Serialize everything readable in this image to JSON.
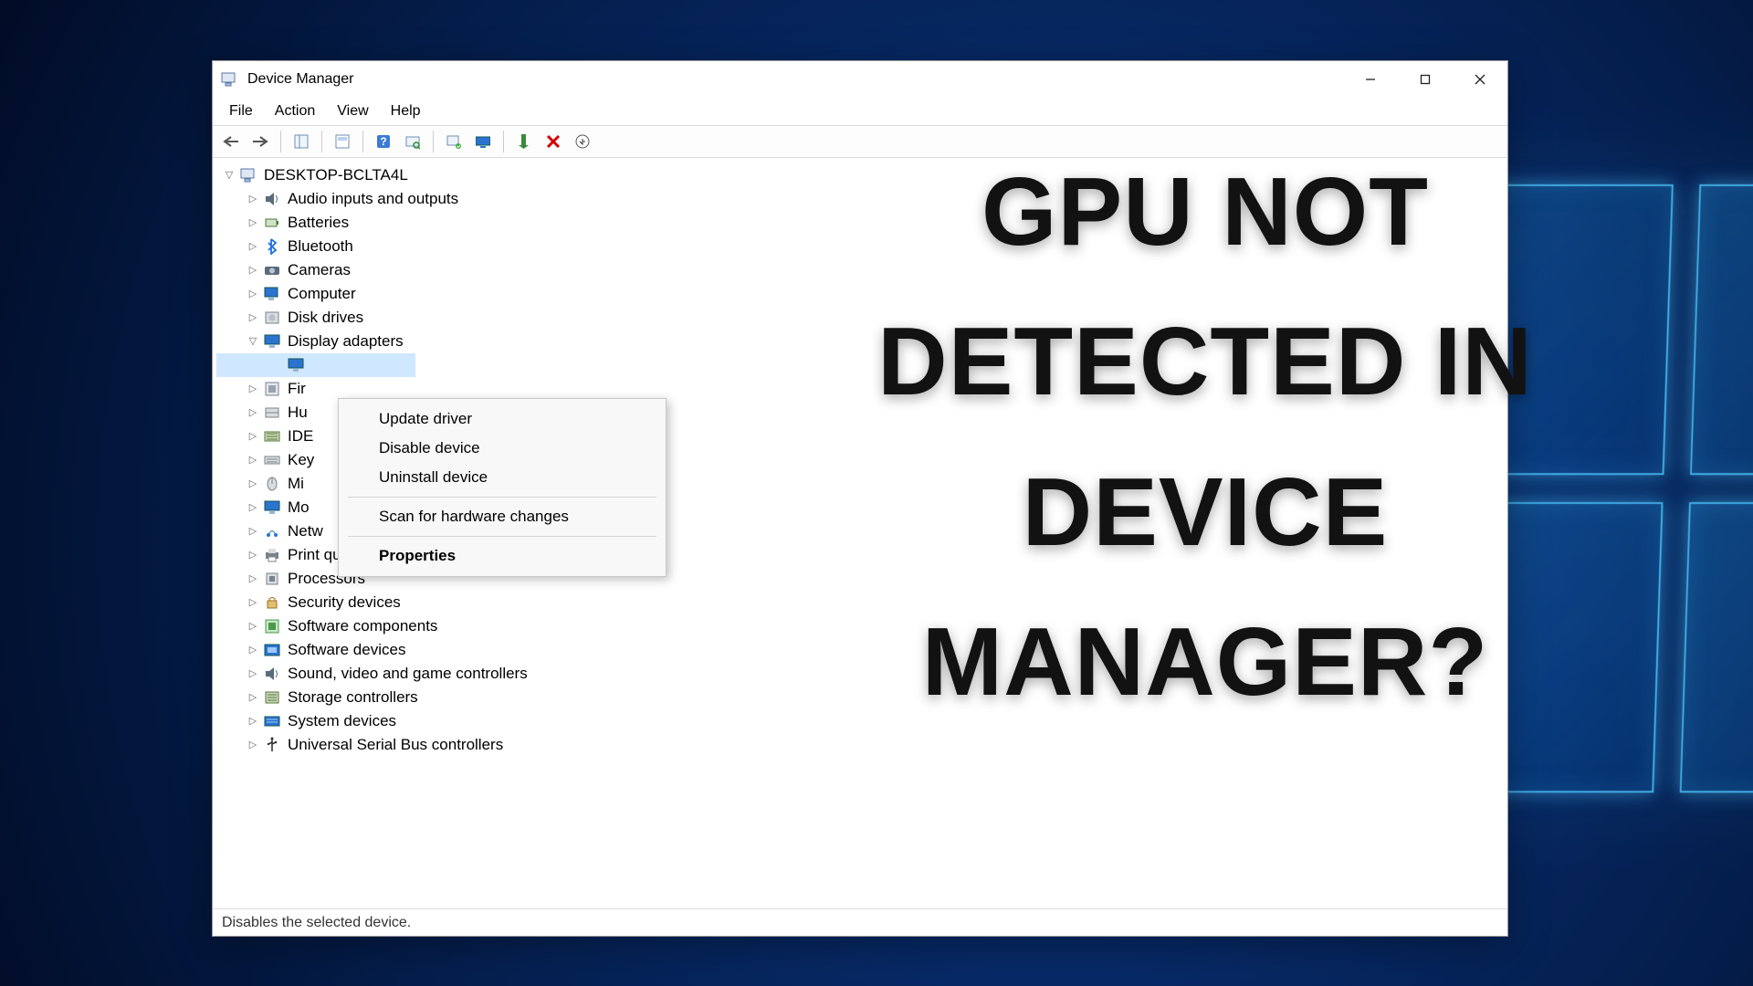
{
  "desktop": {
    "os": "Windows 10"
  },
  "window": {
    "title": "Device Manager",
    "controls": {
      "minimize": "–",
      "maximize": "□",
      "close": "✕"
    }
  },
  "menubar": [
    "File",
    "Action",
    "View",
    "Help"
  ],
  "tree": {
    "root": "DESKTOP-BCLTA4L",
    "items": [
      {
        "label": "Audio inputs and outputs",
        "icon": "speaker"
      },
      {
        "label": "Batteries",
        "icon": "battery"
      },
      {
        "label": "Bluetooth",
        "icon": "bluetooth"
      },
      {
        "label": "Cameras",
        "icon": "camera"
      },
      {
        "label": "Computer",
        "icon": "computer"
      },
      {
        "label": "Disk drives",
        "icon": "disk"
      },
      {
        "label": "Display adapters",
        "icon": "display",
        "expanded": true,
        "children": [
          ""
        ]
      },
      {
        "label": "Fir",
        "truncated": true,
        "icon": "firmware"
      },
      {
        "label": "Hu",
        "truncated": true,
        "icon": "hid"
      },
      {
        "label": "IDE",
        "truncated": true,
        "icon": "ide"
      },
      {
        "label": "Key",
        "truncated": true,
        "icon": "keyboard"
      },
      {
        "label": "Mi",
        "truncated": true,
        "icon": "mouse"
      },
      {
        "label": "Mo",
        "truncated": true,
        "icon": "monitor"
      },
      {
        "label": "Netw",
        "truncated": true,
        "icon": "network"
      },
      {
        "label": "Print queues",
        "icon": "printer"
      },
      {
        "label": "Processors",
        "icon": "cpu"
      },
      {
        "label": "Security devices",
        "icon": "security"
      },
      {
        "label": "Software components",
        "icon": "swcomp"
      },
      {
        "label": "Software devices",
        "icon": "swdev"
      },
      {
        "label": "Sound, video and game controllers",
        "icon": "sound"
      },
      {
        "label": "Storage controllers",
        "icon": "storage"
      },
      {
        "label": "System devices",
        "icon": "system"
      },
      {
        "label": "Universal Serial Bus controllers",
        "icon": "usb"
      }
    ]
  },
  "context_menu": {
    "items": [
      {
        "label": "Update driver"
      },
      {
        "label": "Disable device"
      },
      {
        "label": "Uninstall device"
      },
      {
        "sep": true
      },
      {
        "label": "Scan for hardware changes"
      },
      {
        "sep": true
      },
      {
        "label": "Properties",
        "bold": true
      }
    ]
  },
  "statusbar": {
    "text": "Disables the selected device."
  },
  "overlay": {
    "headline": "GPU NOT DETECTED IN DEVICE MANAGER?"
  }
}
